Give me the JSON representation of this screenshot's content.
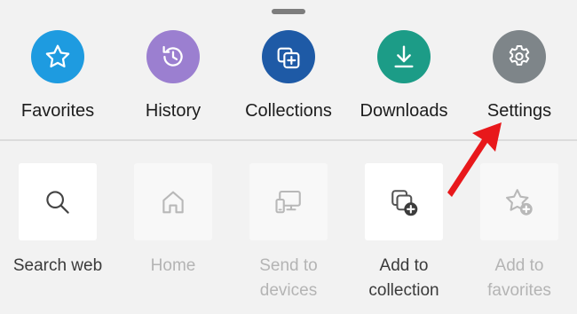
{
  "menu": {
    "top_items": [
      {
        "label": "Favorites",
        "icon": "star-icon",
        "color": "#1e9be0"
      },
      {
        "label": "History",
        "icon": "history-icon",
        "color": "#9b7fd0"
      },
      {
        "label": "Collections",
        "icon": "collections-icon",
        "color": "#1e5aa6"
      },
      {
        "label": "Downloads",
        "icon": "download-icon",
        "color": "#1c9c87"
      },
      {
        "label": "Settings",
        "icon": "gear-icon",
        "color": "#7e8589"
      }
    ],
    "bottom_items": [
      {
        "label": "Search web",
        "icon": "search-icon",
        "enabled": true
      },
      {
        "label": "Home",
        "icon": "home-icon",
        "enabled": false
      },
      {
        "label": "Send to\ndevices",
        "icon": "send-to-devices-icon",
        "enabled": false
      },
      {
        "label": "Add to\ncollection",
        "icon": "add-to-collection-icon",
        "enabled": true
      },
      {
        "label": "Add to\nfavorites",
        "icon": "add-to-favorites-icon",
        "enabled": false
      }
    ]
  },
  "annotation": {
    "icon": "red-arrow-pointer",
    "color": "#e8181b"
  }
}
